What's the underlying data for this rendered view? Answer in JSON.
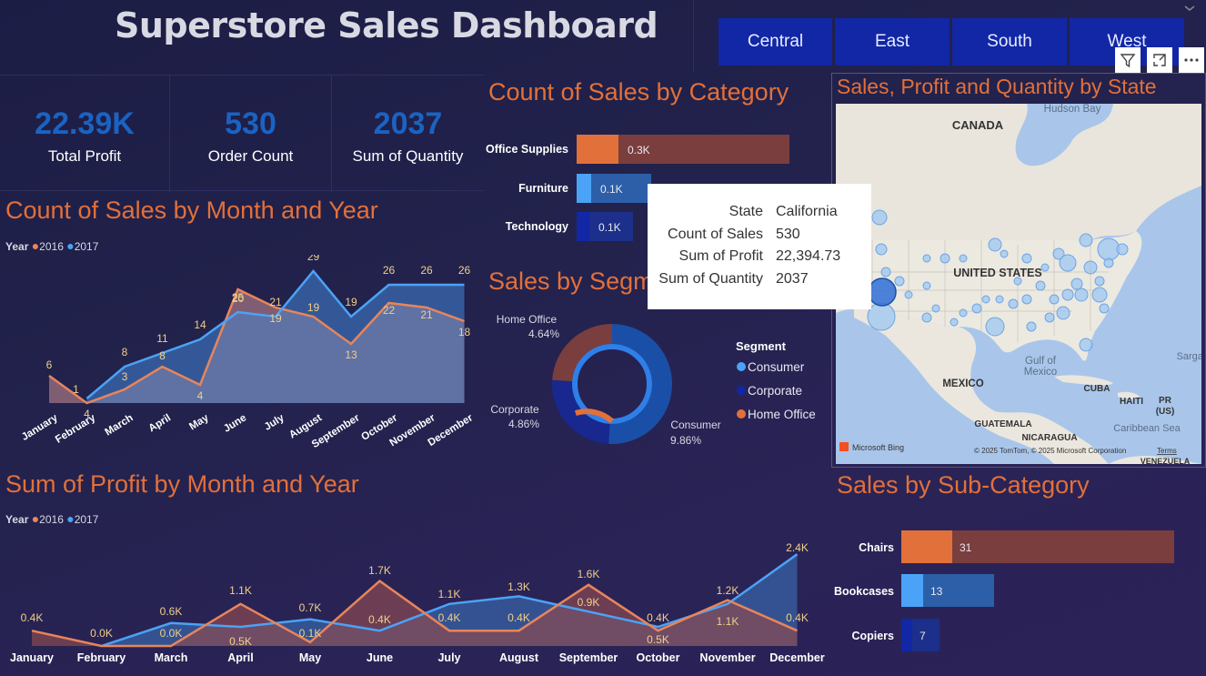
{
  "header": {
    "title": "Superstore Sales Dashboard"
  },
  "region_slicer": {
    "options": [
      "Central",
      "East",
      "South",
      "West"
    ]
  },
  "kpis": [
    {
      "value": "22.39K",
      "label": "Total Profit"
    },
    {
      "value": "530",
      "label": "Order Count"
    },
    {
      "value": "2037",
      "label": "Sum of Quantity"
    }
  ],
  "visual_icons": [
    "filter-icon",
    "focus-mode-icon",
    "more-options-icon",
    "chevron-down-icon"
  ],
  "colors": {
    "orange": "#e2703a",
    "blue": "#4aa3f7",
    "navy": "#1127a6",
    "kpi_blue": "#1a63c2",
    "title_orange": "#e2703a"
  },
  "category_chart": {
    "title": "Count of Sales by Category",
    "bars": [
      {
        "label": "Office Supplies",
        "value_label": "0.3K"
      },
      {
        "label": "Furniture",
        "value_label": "0.1K"
      },
      {
        "label": "Technology",
        "value_label": "0.1K"
      }
    ]
  },
  "segment_chart": {
    "title": "Sales by Segm",
    "legend_title": "Segment",
    "legend": [
      "Consumer",
      "Corporate",
      "Home Office"
    ],
    "slice_labels": [
      {
        "name": "Home Office",
        "pct": "4.64%"
      },
      {
        "name": "Corporate",
        "pct": "4.86%"
      },
      {
        "name": "Consumer",
        "pct": "9.86%"
      }
    ]
  },
  "tooltip": {
    "rows": [
      {
        "key": "State",
        "value": "California"
      },
      {
        "key": "Count of Sales",
        "value": "530"
      },
      {
        "key": "Sum of Profit",
        "value": "22,394.73"
      },
      {
        "key": "Sum of Quantity",
        "value": "2037"
      }
    ]
  },
  "map": {
    "title": "Sales, Profit and Quantity by State",
    "labels": {
      "canada": "CANADA",
      "hudson_bay": "Hudson Bay",
      "us": "UNITED STATES",
      "mexico": "MEXICO",
      "gulf": "Gulf of",
      "gulf2": "Mexico",
      "cuba": "CUBA",
      "haiti": "HAITI",
      "pr": "PR",
      "pr2": "(US)",
      "guatemala": "GUATEMALA",
      "nicaragua": "NICARAGUA",
      "caribbean": "Caribbean Sea",
      "sargasso": "Sargas",
      "venezuela": "VENEZUELA"
    },
    "attribution": "© 2025 TomTom, © 2025 Microsoft Corporation",
    "terms": "Terms",
    "brand": "Microsoft Bing"
  },
  "count_month_chart": {
    "title": "Count of Sales by Month and Year",
    "legend_title": "Year",
    "legend": [
      "2016",
      "2017"
    ],
    "label_2016": [
      "6",
      "4",
      "3",
      "8",
      "4",
      "20",
      "19",
      "19",
      "13",
      "22",
      "21",
      "18"
    ],
    "label_2017": [
      "",
      "1",
      "8",
      "11",
      "14",
      "25",
      "21",
      "29",
      "19",
      "26",
      "26",
      "26"
    ]
  },
  "profit_month_chart": {
    "title": "Sum of Profit by Month and Year",
    "legend_title": "Year",
    "legend": [
      "2016",
      "2017"
    ],
    "label_2016": [
      "0.4K",
      "",
      "",
      "1.1K",
      "0.7K",
      "1.7K",
      "0.4K",
      "0.4K",
      "1.6K",
      "0.4K",
      "1.2K",
      "0.4K"
    ],
    "label_2017": [
      "",
      "0.0K",
      "0.6K",
      "0.5K",
      "0.1K",
      "0.4K",
      "1.1K",
      "1.3K",
      "0.9K",
      "0.5K",
      "1.1K",
      "2.4K"
    ],
    "label_extra": [
      "",
      "",
      "0.0K",
      "",
      "",
      "",
      "",
      "",
      "",
      "",
      "",
      ""
    ]
  },
  "subcategory_chart": {
    "title": "Sales by Sub-Category",
    "bars": [
      {
        "label": "Chairs",
        "value": "31"
      },
      {
        "label": "Bookcases",
        "value": "13"
      },
      {
        "label": "Copiers",
        "value": "7"
      }
    ]
  },
  "chart_data": [
    {
      "type": "area",
      "title": "Count of Sales by Month and Year",
      "categories": [
        "January",
        "February",
        "March",
        "April",
        "May",
        "June",
        "July",
        "August",
        "September",
        "October",
        "November",
        "December"
      ],
      "series": [
        {
          "name": "2016",
          "values": [
            6,
            0,
            3,
            8,
            4,
            25,
            21,
            19,
            13,
            22,
            21,
            18
          ]
        },
        {
          "name": "2017",
          "values": [
            null,
            1,
            8,
            11,
            14,
            20,
            19,
            29,
            19,
            26,
            26,
            26
          ]
        }
      ],
      "legend": "top-left"
    },
    {
      "type": "area",
      "title": "Sum of Profit by Month and Year",
      "categories": [
        "January",
        "February",
        "March",
        "April",
        "May",
        "June",
        "July",
        "August",
        "September",
        "October",
        "November",
        "December"
      ],
      "series": [
        {
          "name": "2016",
          "values": [
            0.4,
            0.0,
            0.0,
            1.1,
            0.1,
            1.7,
            0.4,
            0.4,
            1.6,
            0.4,
            1.2,
            0.4
          ]
        },
        {
          "name": "2017",
          "values": [
            null,
            0.0,
            0.6,
            0.5,
            0.7,
            0.4,
            1.1,
            1.3,
            0.9,
            0.5,
            1.1,
            2.4
          ]
        }
      ],
      "legend": "top-left"
    },
    {
      "type": "bar",
      "title": "Count of Sales by Category",
      "categories": [
        "Office Supplies",
        "Furniture",
        "Technology"
      ],
      "values": [
        0.3,
        0.1,
        0.1
      ]
    },
    {
      "type": "pie",
      "title": "Sales by Segm",
      "categories": [
        "Consumer",
        "Corporate",
        "Home Office"
      ],
      "values": [
        9.86,
        4.86,
        4.64
      ]
    },
    {
      "type": "bar",
      "title": "Sales by Sub-Category",
      "categories": [
        "Chairs",
        "Bookcases",
        "Copiers"
      ],
      "values": [
        31,
        13,
        7
      ]
    }
  ]
}
